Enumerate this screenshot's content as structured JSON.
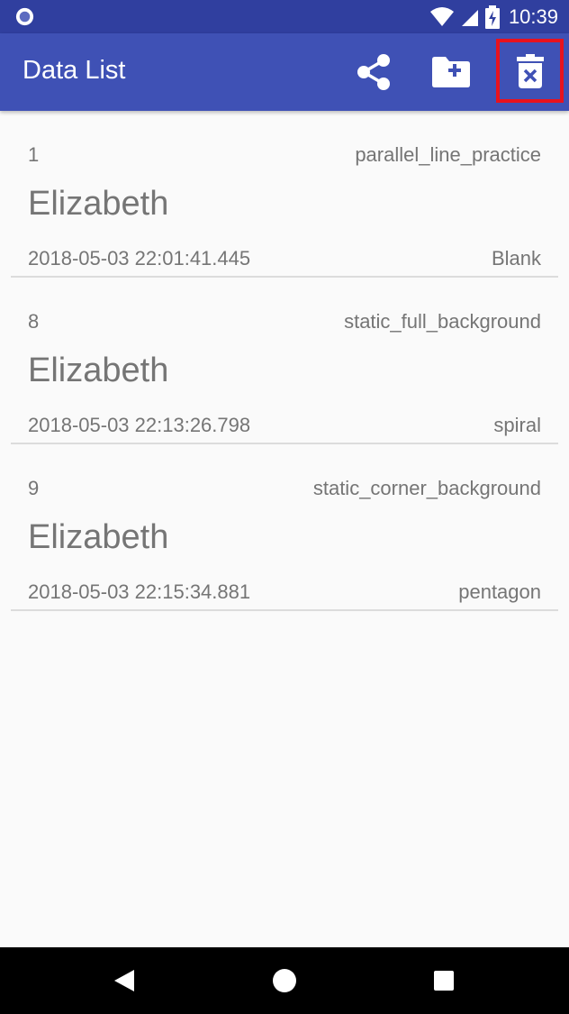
{
  "status_bar": {
    "time": "10:39",
    "icons": [
      "notification-circle-icon",
      "wifi-icon",
      "cell-signal-icon",
      "battery-charging-icon"
    ]
  },
  "app_bar": {
    "title": "Data List",
    "actions": [
      {
        "name": "share",
        "icon": "share-icon"
      },
      {
        "name": "create-folder",
        "icon": "folder-plus-icon"
      },
      {
        "name": "delete",
        "icon": "trash-x-icon"
      }
    ],
    "highlight_color": "#e8121e",
    "color": "#3f51b5",
    "status_color": "#303f9f"
  },
  "items": [
    {
      "id": "1",
      "type": "parallel_line_practice",
      "name": "Elizabeth",
      "timestamp": "2018-05-03 22:01:41.445",
      "shape": "Blank"
    },
    {
      "id": "8",
      "type": "static_full_background",
      "name": "Elizabeth",
      "timestamp": "2018-05-03 22:13:26.798",
      "shape": "spiral"
    },
    {
      "id": "9",
      "type": "static_corner_background",
      "name": "Elizabeth",
      "timestamp": "2018-05-03 22:15:34.881",
      "shape": "pentagon"
    }
  ],
  "nav_bar": {
    "buttons": [
      "back-icon",
      "home-icon",
      "recents-icon"
    ]
  }
}
